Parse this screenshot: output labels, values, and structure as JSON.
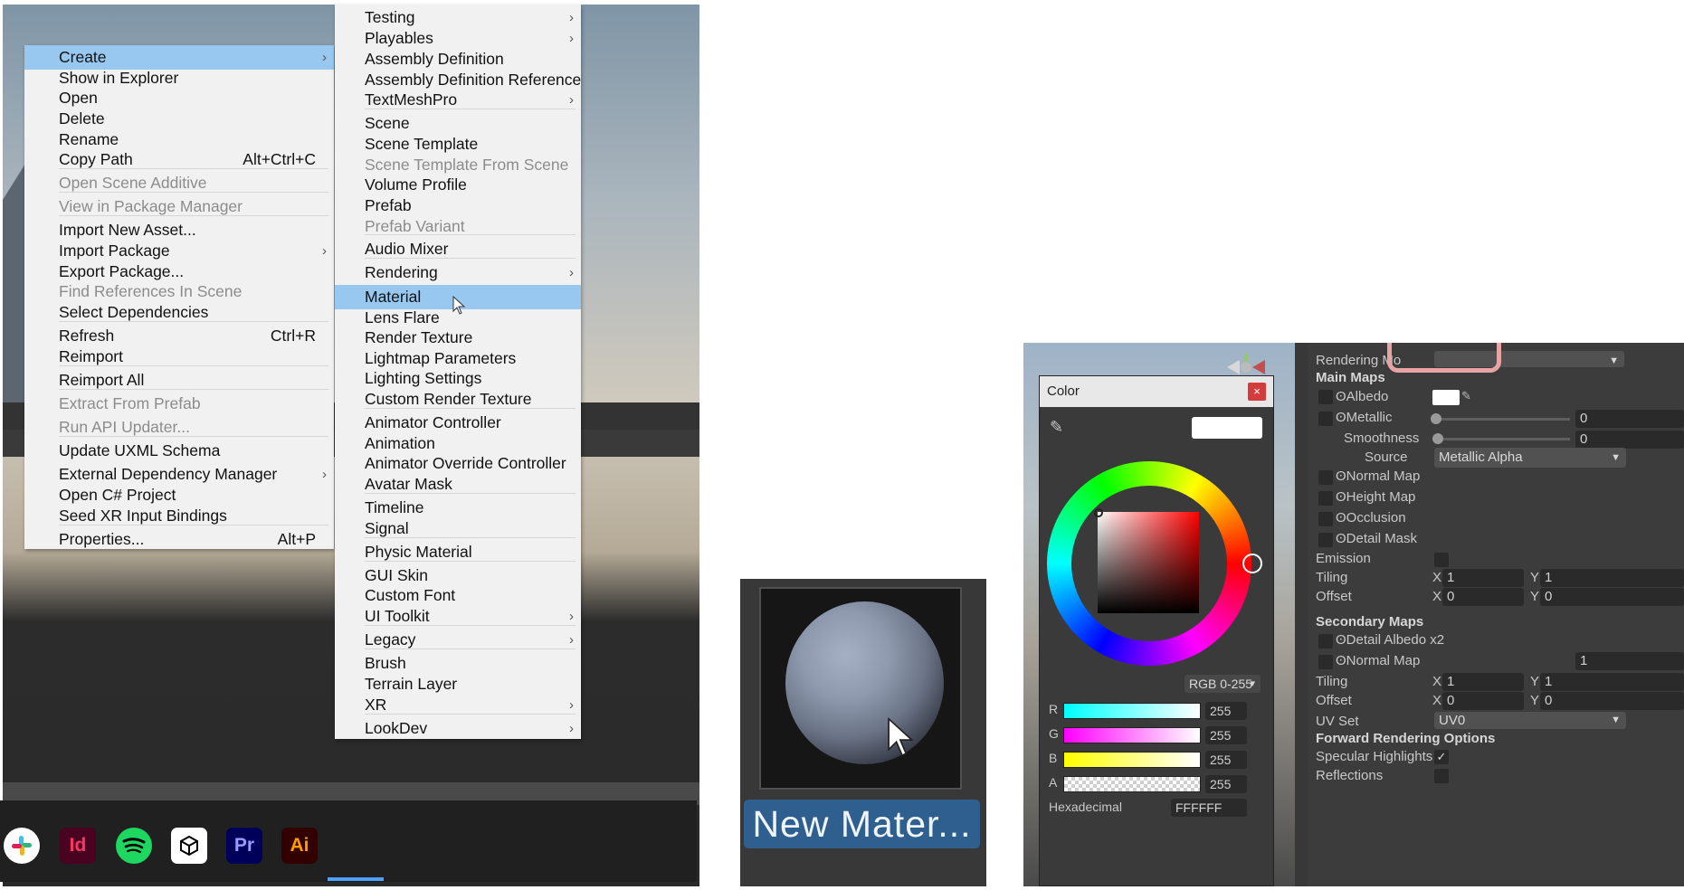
{
  "context_menu": {
    "items": [
      {
        "label": "Create",
        "shortcut": "",
        "submenu": true,
        "disabled": false,
        "highlighted": true
      },
      {
        "label": "Show in Explorer",
        "shortcut": "",
        "submenu": false,
        "disabled": false
      },
      {
        "label": "Open",
        "shortcut": "",
        "submenu": false,
        "disabled": false
      },
      {
        "label": "Delete",
        "shortcut": "",
        "submenu": false,
        "disabled": false
      },
      {
        "label": "Rename",
        "shortcut": "",
        "submenu": false,
        "disabled": false
      },
      {
        "label": "Copy Path",
        "shortcut": "Alt+Ctrl+C",
        "submenu": false,
        "disabled": false
      },
      {
        "label": "Open Scene Additive",
        "shortcut": "",
        "submenu": false,
        "disabled": true
      },
      {
        "label": "View in Package Manager",
        "shortcut": "",
        "submenu": false,
        "disabled": true
      },
      {
        "label": "Import New Asset...",
        "shortcut": "",
        "submenu": false,
        "disabled": false
      },
      {
        "label": "Import Package",
        "shortcut": "",
        "submenu": true,
        "disabled": false
      },
      {
        "label": "Export Package...",
        "shortcut": "",
        "submenu": false,
        "disabled": false
      },
      {
        "label": "Find References In Scene",
        "shortcut": "",
        "submenu": false,
        "disabled": true
      },
      {
        "label": "Select Dependencies",
        "shortcut": "",
        "submenu": false,
        "disabled": false
      },
      {
        "label": "Refresh",
        "shortcut": "Ctrl+R",
        "submenu": false,
        "disabled": false
      },
      {
        "label": "Reimport",
        "shortcut": "",
        "submenu": false,
        "disabled": false
      },
      {
        "label": "Reimport All",
        "shortcut": "",
        "submenu": false,
        "disabled": false
      },
      {
        "label": "Extract From Prefab",
        "shortcut": "",
        "submenu": false,
        "disabled": true
      },
      {
        "label": "Run API Updater...",
        "shortcut": "",
        "submenu": false,
        "disabled": true
      },
      {
        "label": "Update UXML Schema",
        "shortcut": "",
        "submenu": false,
        "disabled": false
      },
      {
        "label": "External Dependency Manager",
        "shortcut": "",
        "submenu": true,
        "disabled": false
      },
      {
        "label": "Open C# Project",
        "shortcut": "",
        "submenu": false,
        "disabled": false
      },
      {
        "label": "Seed XR Input Bindings",
        "shortcut": "",
        "submenu": false,
        "disabled": false
      },
      {
        "label": "Properties...",
        "shortcut": "Alt+P",
        "submenu": false,
        "disabled": false
      }
    ]
  },
  "create_submenu": {
    "items": [
      {
        "label": "Testing",
        "submenu": true
      },
      {
        "label": "Playables",
        "submenu": true
      },
      {
        "label": "Assembly Definition"
      },
      {
        "label": "Assembly Definition Reference"
      },
      {
        "label": "TextMeshPro",
        "submenu": true
      },
      {
        "label": "Scene"
      },
      {
        "label": "Scene Template"
      },
      {
        "label": "Scene Template From Scene",
        "disabled": true
      },
      {
        "label": "Volume Profile"
      },
      {
        "label": "Prefab"
      },
      {
        "label": "Prefab Variant",
        "disabled": true
      },
      {
        "label": "Audio Mixer"
      },
      {
        "label": "Rendering",
        "submenu": true
      },
      {
        "label": "Material",
        "highlighted": true
      },
      {
        "label": "Lens Flare"
      },
      {
        "label": "Render Texture"
      },
      {
        "label": "Lightmap Parameters"
      },
      {
        "label": "Lighting Settings"
      },
      {
        "label": "Custom Render Texture"
      },
      {
        "label": "Animator Controller"
      },
      {
        "label": "Animation"
      },
      {
        "label": "Animator Override Controller"
      },
      {
        "label": "Avatar Mask"
      },
      {
        "label": "Timeline"
      },
      {
        "label": "Signal"
      },
      {
        "label": "Physic Material"
      },
      {
        "label": "GUI Skin"
      },
      {
        "label": "Custom Font"
      },
      {
        "label": "UI Toolkit",
        "submenu": true
      },
      {
        "label": "Legacy",
        "submenu": true
      },
      {
        "label": "Brush"
      },
      {
        "label": "Terrain Layer"
      },
      {
        "label": "XR",
        "submenu": true
      },
      {
        "label": "LookDev",
        "submenu": true
      }
    ]
  },
  "taskbar": {
    "icons": [
      {
        "name": "slack-icon",
        "label": "",
        "bg": "#ffffff",
        "fg": "#e01e5a"
      },
      {
        "name": "indesign-icon",
        "label": "Id",
        "bg": "#49021f",
        "fg": "#ff3366"
      },
      {
        "name": "spotify-icon",
        "label": "",
        "bg": "#1ed760",
        "fg": "#000000"
      },
      {
        "name": "unity-icon",
        "label": "",
        "bg": "#ffffff",
        "fg": "#000000"
      },
      {
        "name": "premiere-icon",
        "label": "Pr",
        "bg": "#00005b",
        "fg": "#9999ff"
      },
      {
        "name": "illustrator-icon",
        "label": "Ai",
        "bg": "#330000",
        "fg": "#ff9a00"
      }
    ]
  },
  "material_preview": {
    "name": "New Mater..."
  },
  "color_picker": {
    "title": "Color",
    "close": "×",
    "mode": "RGB 0-255",
    "channels": [
      {
        "label": "R",
        "value": "255"
      },
      {
        "label": "G",
        "value": "255"
      },
      {
        "label": "B",
        "value": "255"
      },
      {
        "label": "A",
        "value": "255"
      }
    ],
    "hex_label": "Hexadecimal",
    "hex_value": "FFFFFF",
    "current_color": "#ffffff"
  },
  "inspector": {
    "rendering_mode_label": "Rendering Mo",
    "main_maps": "Main Maps",
    "albedo": "Albedo",
    "metallic": "Metallic",
    "metallic_value": "0",
    "smoothness": "Smoothness",
    "smoothness_value": "0",
    "source": "Source",
    "source_value": "Metallic Alpha",
    "normal_map": "Normal Map",
    "height_map": "Height Map",
    "occlusion": "Occlusion",
    "detail_mask": "Detail Mask",
    "emission": "Emission",
    "tiling": "Tiling",
    "offset": "Offset",
    "x": "X",
    "y": "Y",
    "tiling_x": "1",
    "tiling_y": "1",
    "offset_x": "0",
    "offset_y": "0",
    "secondary_maps": "Secondary Maps",
    "detail_albedo": "Detail Albedo x2",
    "normal_map2": "Normal Map",
    "normal_map2_value": "1",
    "tiling2_x": "1",
    "tiling2_y": "1",
    "offset2_x": "0",
    "offset2_y": "0",
    "uv_set": "UV Set",
    "uv_set_value": "UV0",
    "forward_options": "Forward Rendering Options",
    "specular": "Specular Highlights",
    "reflections": "Reflections",
    "highlight_color": "#e8a4a4"
  }
}
